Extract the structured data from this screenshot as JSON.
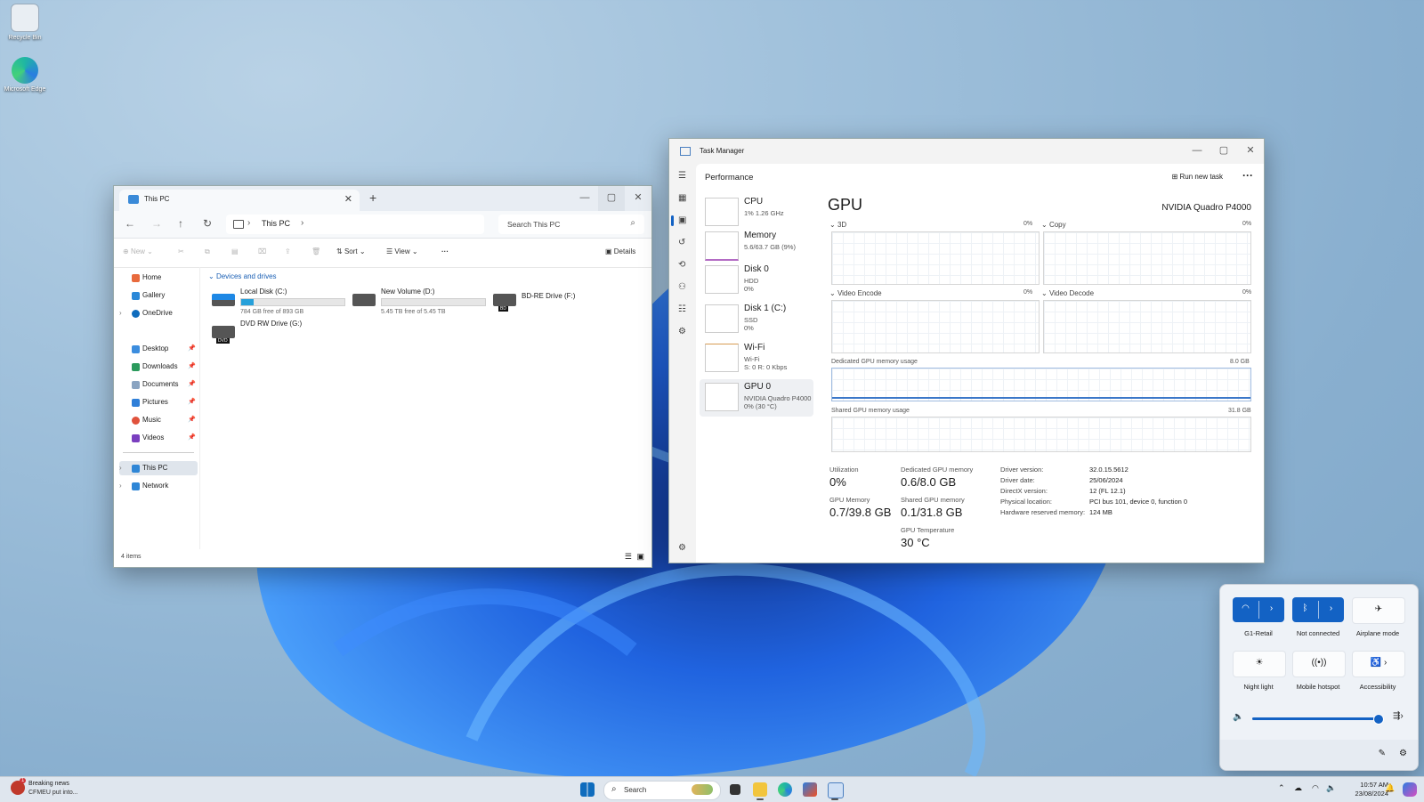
{
  "desktop": {
    "icons": [
      {
        "label": "Recycle Bin"
      },
      {
        "label": "Microsoft Edge"
      }
    ]
  },
  "explorer": {
    "tab_title": "This PC",
    "address": "This PC",
    "search_placeholder": "Search This PC",
    "commands": {
      "new": "New",
      "sort": "Sort",
      "view": "View",
      "details": "Details"
    },
    "sidebar": [
      {
        "label": "Home"
      },
      {
        "label": "Gallery"
      },
      {
        "label": "OneDrive"
      },
      {
        "label": "Desktop"
      },
      {
        "label": "Downloads"
      },
      {
        "label": "Documents"
      },
      {
        "label": "Pictures"
      },
      {
        "label": "Music"
      },
      {
        "label": "Videos"
      },
      {
        "label": "This PC"
      },
      {
        "label": "Network"
      }
    ],
    "group_label": "Devices and drives",
    "drives": [
      {
        "name": "Local Disk (C:)",
        "free": "784 GB free of 893 GB",
        "used_fraction": 0.12
      },
      {
        "name": "New Volume (D:)",
        "free": "5.45 TB free of 5.45 TB",
        "used_fraction": 0.0
      },
      {
        "name": "BD-RE Drive (F:)",
        "badge": "BD"
      },
      {
        "name": "DVD RW Drive (G:)",
        "badge": "DVD"
      }
    ],
    "status": "4 items"
  },
  "taskmgr": {
    "title": "Task Manager",
    "header": "Performance",
    "run_task": "Run new task",
    "perf_items": [
      {
        "name": "CPU",
        "sub1": "1% 1.26 GHz",
        "sub2": ""
      },
      {
        "name": "Memory",
        "sub1": "5.6/63.7 GB (9%)",
        "sub2": ""
      },
      {
        "name": "Disk 0",
        "sub1": "HDD",
        "sub2": "0%"
      },
      {
        "name": "Disk 1 (C:)",
        "sub1": "SSD",
        "sub2": "0%"
      },
      {
        "name": "Wi-Fi",
        "sub1": "Wi-Fi",
        "sub2": "S: 0 R: 0 Kbps"
      },
      {
        "name": "GPU 0",
        "sub1": "NVIDIA Quadro P4000",
        "sub2": "0% (30 °C)"
      }
    ],
    "gpu_title": "GPU",
    "gpu_name": "NVIDIA Quadro P4000",
    "graphs": {
      "3d": "3D",
      "copy": "Copy",
      "video_encode": "Video Encode",
      "video_decode": "Video Decode",
      "pct": "0%",
      "dedicated_label": "Dedicated GPU memory usage",
      "dedicated_max": "8.0 GB",
      "shared_label": "Shared GPU memory usage",
      "shared_max": "31.8 GB"
    },
    "stats": {
      "utilization_label": "Utilization",
      "utilization": "0%",
      "dedicated_label": "Dedicated GPU memory",
      "dedicated": "0.6/8.0 GB",
      "gpu_mem_label": "GPU Memory",
      "gpu_mem": "0.7/39.8 GB",
      "shared_label": "Shared GPU memory",
      "shared": "0.1/31.8 GB",
      "temp_label": "GPU Temperature",
      "temp": "30 °C"
    },
    "details": [
      {
        "k": "Driver version:",
        "v": "32.0.15.5612"
      },
      {
        "k": "Driver date:",
        "v": "25/06/2024"
      },
      {
        "k": "DirectX version:",
        "v": "12 (FL 12.1)"
      },
      {
        "k": "Physical location:",
        "v": "PCI bus 101, device 0, function 0"
      },
      {
        "k": "Hardware reserved memory:",
        "v": "124 MB"
      }
    ]
  },
  "quick": {
    "tiles": [
      {
        "label": "G1-Retail",
        "on": true
      },
      {
        "label": "Not connected",
        "on": true
      },
      {
        "label": "Airplane mode",
        "on": false
      },
      {
        "label": "Night light",
        "on": false
      },
      {
        "label": "Mobile hotspot",
        "on": false
      },
      {
        "label": "Accessibility",
        "on": false
      }
    ],
    "volume_fraction": 0.98
  },
  "taskbar": {
    "news_title": "Breaking news",
    "news_sub": "CFMEU put into...",
    "news_badge": "1",
    "search_placeholder": "Search",
    "time": "10:57 AM",
    "date": "23/08/2024"
  },
  "colors": {
    "accent": "#1362c4",
    "bloom": "#1d6ff2"
  }
}
